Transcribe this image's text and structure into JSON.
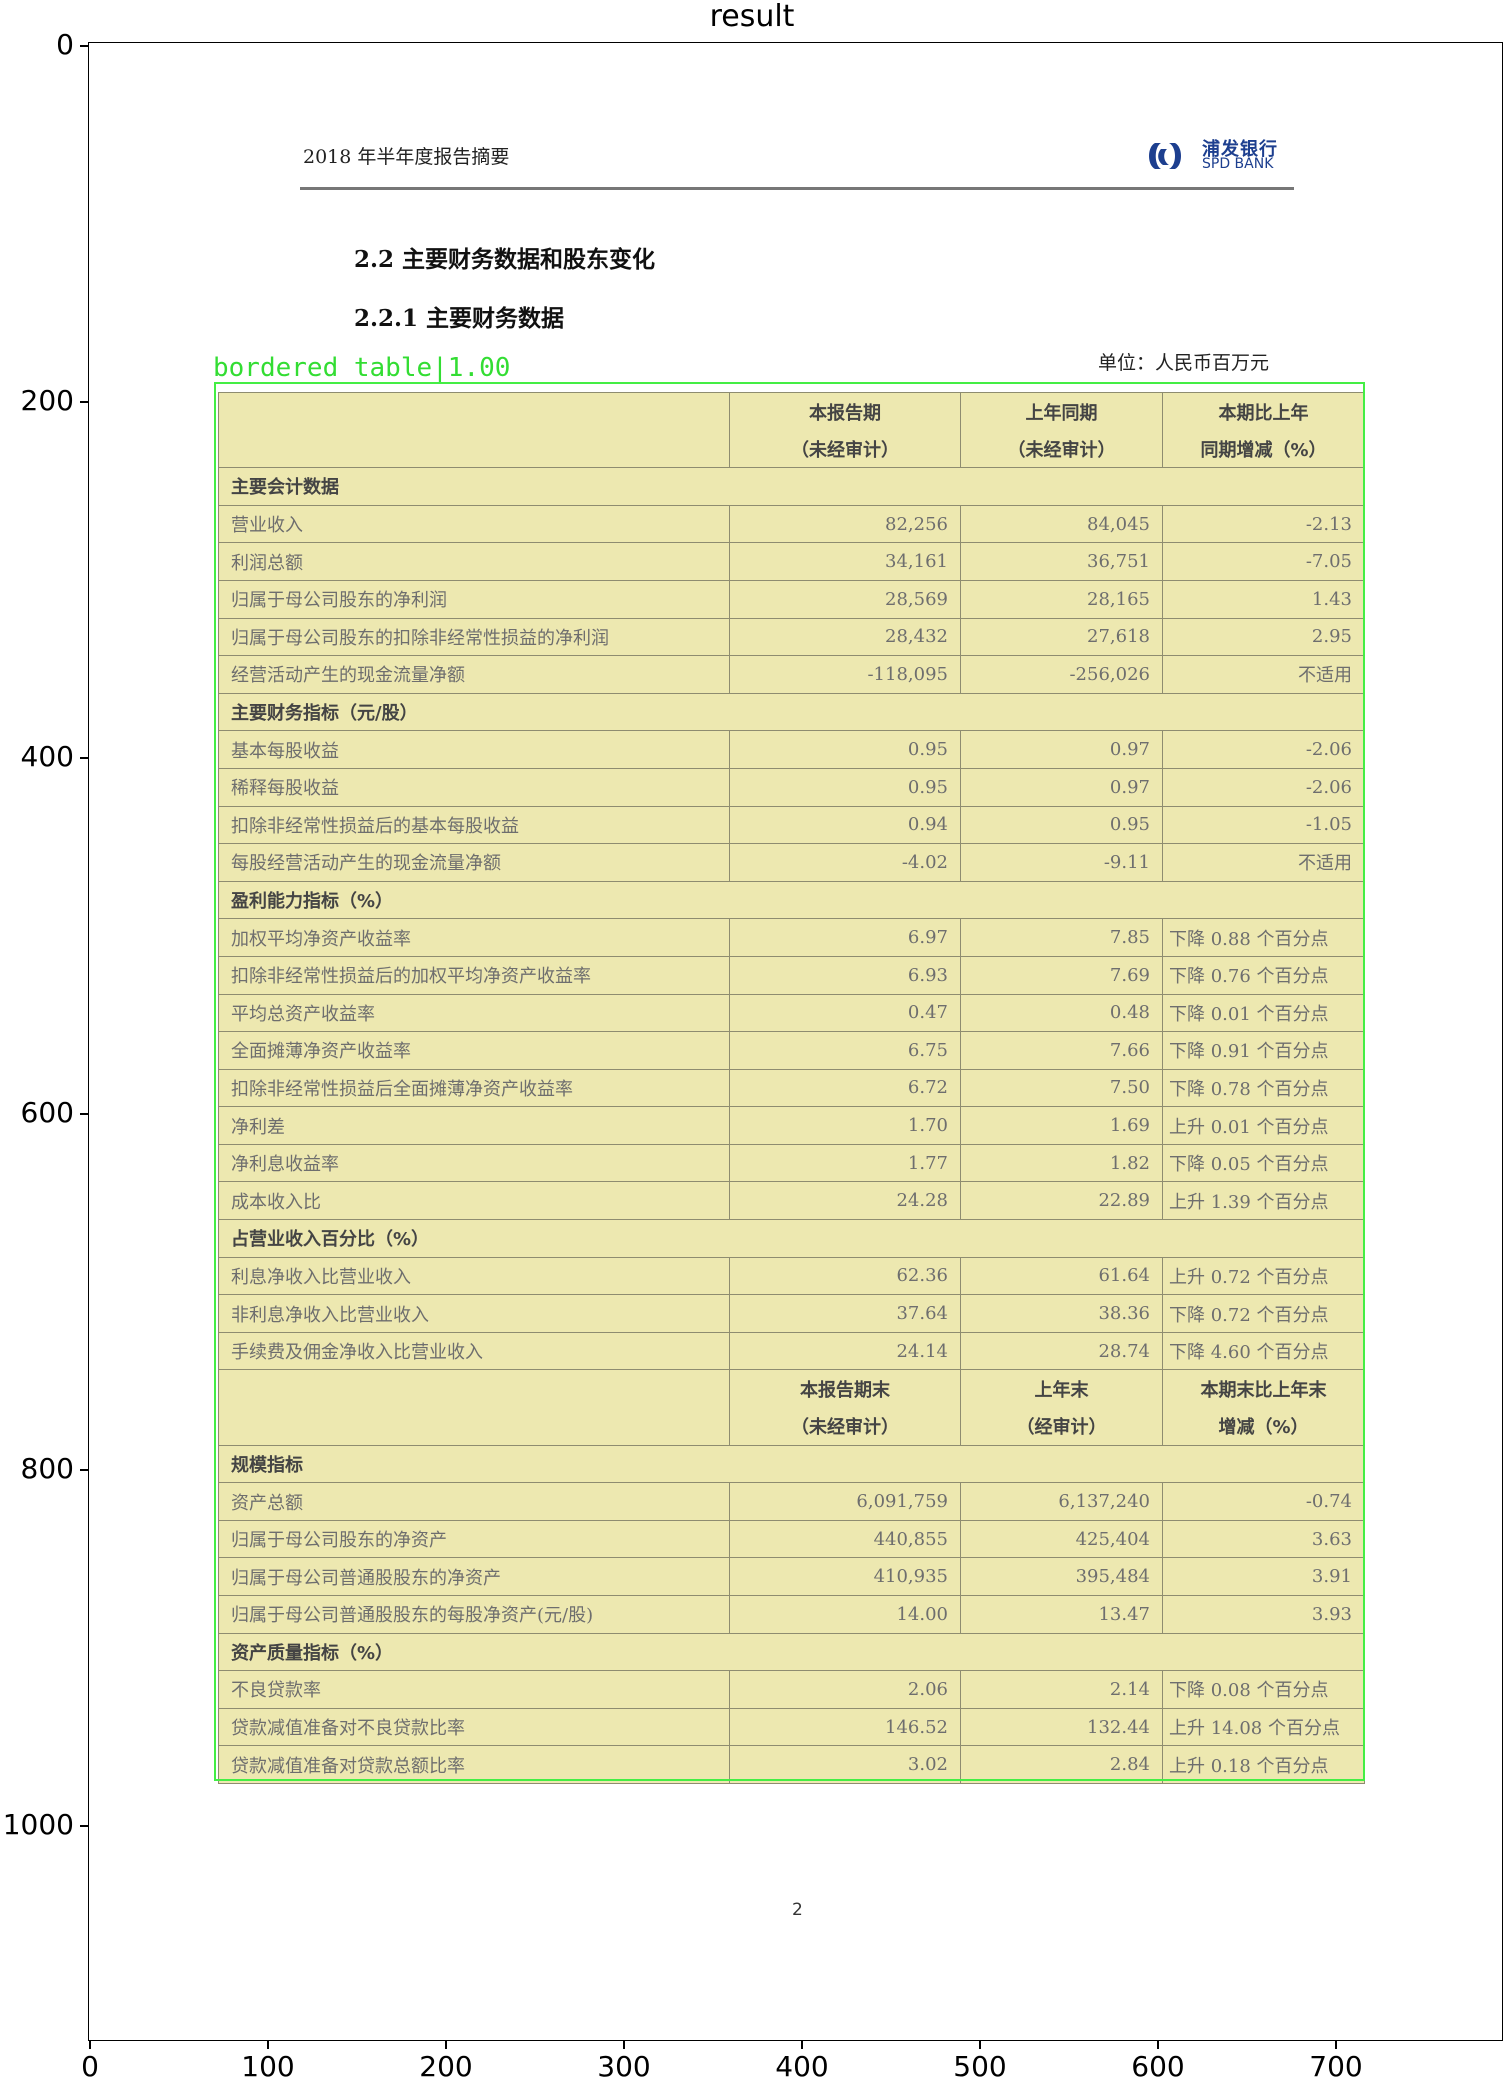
{
  "figure": {
    "title": "result"
  },
  "axes": {
    "y_ticks": [
      "0",
      "200",
      "400",
      "600",
      "800",
      "1000"
    ],
    "x_ticks": [
      "0",
      "100",
      "200",
      "300",
      "400",
      "500",
      "600",
      "700"
    ]
  },
  "document": {
    "header_text": "2018 年半年度报告摘要",
    "logo": {
      "cn": "浦发银行",
      "en": "SPD BANK"
    },
    "section_title": "2.2 主要财务数据和股东变化",
    "subsection_title": "2.2.1 主要财务数据",
    "unit": "单位：人民币百万元",
    "page_number": "2"
  },
  "detection": {
    "label": "bordered table|1.00",
    "color": "#44ee44"
  },
  "table": {
    "header1": {
      "col1_line1": "本报告期",
      "col1_line2": "（未经审计）",
      "col2_line1": "上年同期",
      "col2_line2": "（未经审计）",
      "col3_line1": "本期比上年",
      "col3_line2": "同期增减（%）"
    },
    "sections": [
      {
        "title": "主要会计数据",
        "rows": [
          {
            "label": "营业收入",
            "current": "82,256",
            "prior": "84,045",
            "change": "-2.13"
          },
          {
            "label": "利润总额",
            "current": "34,161",
            "prior": "36,751",
            "change": "-7.05"
          },
          {
            "label": "归属于母公司股东的净利润",
            "current": "28,569",
            "prior": "28,165",
            "change": "1.43"
          },
          {
            "label": "归属于母公司股东的扣除非经常性损益的净利润",
            "current": "28,432",
            "prior": "27,618",
            "change": "2.95"
          },
          {
            "label": "经营活动产生的现金流量净额",
            "current": "-118,095",
            "prior": "-256,026",
            "change": "不适用"
          }
        ]
      },
      {
        "title": "主要财务指标（元/股）",
        "rows": [
          {
            "label": "基本每股收益",
            "current": "0.95",
            "prior": "0.97",
            "change": "-2.06"
          },
          {
            "label": "稀释每股收益",
            "current": "0.95",
            "prior": "0.97",
            "change": "-2.06"
          },
          {
            "label": "扣除非经常性损益后的基本每股收益",
            "current": "0.94",
            "prior": "0.95",
            "change": "-1.05"
          },
          {
            "label": "每股经营活动产生的现金流量净额",
            "current": "-4.02",
            "prior": "-9.11",
            "change": "不适用"
          }
        ]
      },
      {
        "title": "盈利能力指标（%）",
        "rows": [
          {
            "label": "加权平均净资产收益率",
            "current": "6.97",
            "prior": "7.85",
            "change": "下降 0.88 个百分点"
          },
          {
            "label": "扣除非经常性损益后的加权平均净资产收益率",
            "current": "6.93",
            "prior": "7.69",
            "change": "下降 0.76 个百分点"
          },
          {
            "label": "平均总资产收益率",
            "current": "0.47",
            "prior": "0.48",
            "change": "下降 0.01 个百分点"
          },
          {
            "label": "全面摊薄净资产收益率",
            "current": "6.75",
            "prior": "7.66",
            "change": "下降 0.91 个百分点"
          },
          {
            "label": "扣除非经常性损益后全面摊薄净资产收益率",
            "current": "6.72",
            "prior": "7.50",
            "change": "下降 0.78 个百分点"
          },
          {
            "label": "净利差",
            "current": "1.70",
            "prior": "1.69",
            "change": "上升 0.01 个百分点"
          },
          {
            "label": "净利息收益率",
            "current": "1.77",
            "prior": "1.82",
            "change": "下降 0.05 个百分点"
          },
          {
            "label": "成本收入比",
            "current": "24.28",
            "prior": "22.89",
            "change": "上升 1.39 个百分点"
          }
        ]
      },
      {
        "title": "占营业收入百分比（%）",
        "rows": [
          {
            "label": "利息净收入比营业收入",
            "current": "62.36",
            "prior": "61.64",
            "change": "上升 0.72 个百分点"
          },
          {
            "label": "非利息净收入比营业收入",
            "current": "37.64",
            "prior": "38.36",
            "change": "下降 0.72 个百分点"
          },
          {
            "label": "手续费及佣金净收入比营业收入",
            "current": "24.14",
            "prior": "28.74",
            "change": "下降 4.60 个百分点"
          }
        ]
      }
    ],
    "header2": {
      "col1_line1": "本报告期末",
      "col1_line2": "（未经审计）",
      "col2_line1": "上年末",
      "col2_line2": "（经审计）",
      "col3_line1": "本期末比上年末",
      "col3_line2": "增减（%）"
    },
    "sections2": [
      {
        "title": "规模指标",
        "rows": [
          {
            "label": "资产总额",
            "current": "6,091,759",
            "prior": "6,137,240",
            "change": "-0.74"
          },
          {
            "label": "归属于母公司股东的净资产",
            "current": "440,855",
            "prior": "425,404",
            "change": "3.63"
          },
          {
            "label": "归属于母公司普通股股东的净资产",
            "current": "410,935",
            "prior": "395,484",
            "change": "3.91"
          },
          {
            "label": "归属于母公司普通股股东的每股净资产(元/股)",
            "current": "14.00",
            "prior": "13.47",
            "change": "3.93"
          }
        ]
      },
      {
        "title": "资产质量指标（%）",
        "rows": [
          {
            "label": "不良贷款率",
            "current": "2.06",
            "prior": "2.14",
            "change": "下降 0.08 个百分点"
          },
          {
            "label": "贷款减值准备对不良贷款比率",
            "current": "146.52",
            "prior": "132.44",
            "change": "上升 14.08 个百分点"
          },
          {
            "label": "贷款减值准备对贷款总额比率",
            "current": "3.02",
            "prior": "2.84",
            "change": "上升 0.18 个百分点"
          }
        ]
      }
    ]
  }
}
